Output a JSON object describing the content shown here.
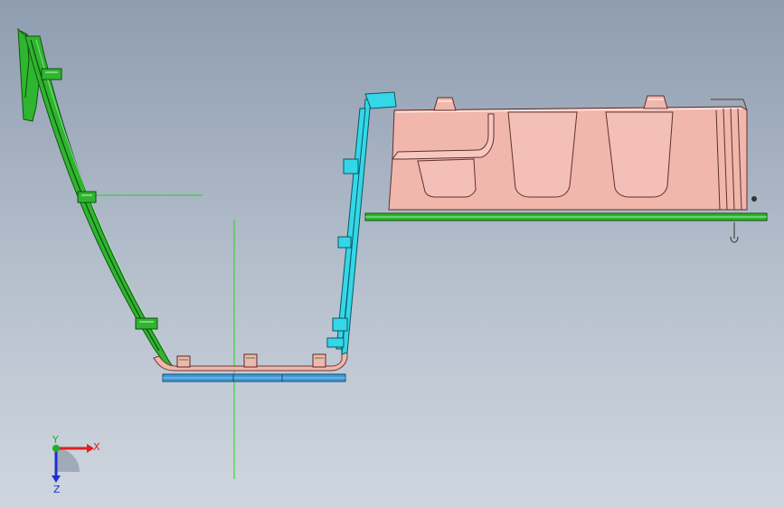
{
  "triad": {
    "x_label": "X",
    "y_label": "Y",
    "z_label": "Z"
  },
  "colors": {
    "background_top": "#8f9db1",
    "background_bottom": "#cfd6df",
    "green_part": "#2fb52f",
    "cyan_part": "#33d7e8",
    "pink_part": "#f1b6ac",
    "blue_base": "#3f9ad6",
    "sketch_line": "#27d027",
    "axis_x": "#e02020",
    "axis_y": "#20b020",
    "axis_z": "#2030d0"
  }
}
